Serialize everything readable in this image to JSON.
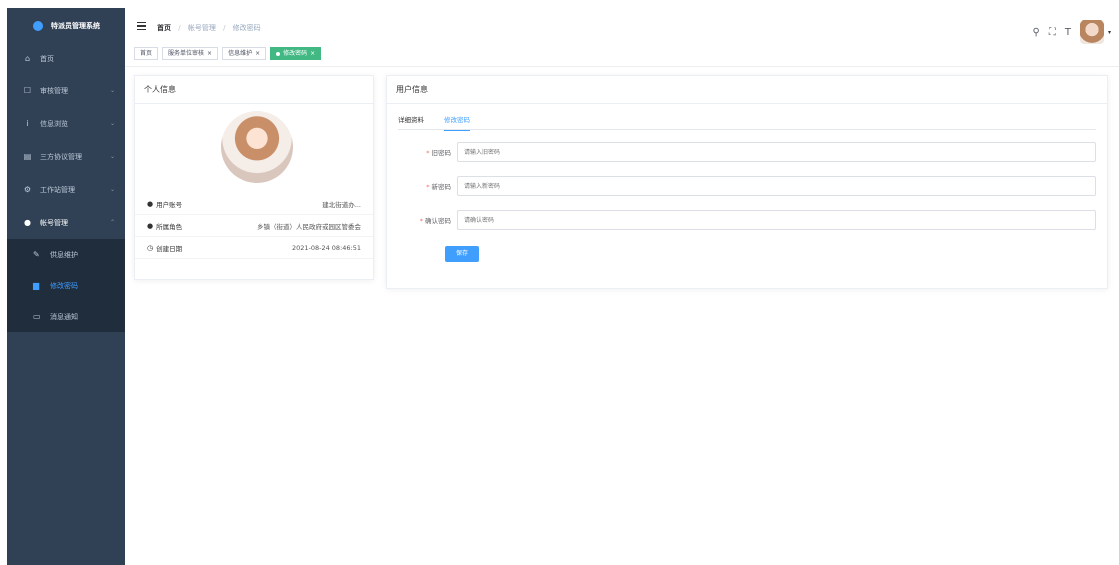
{
  "app": {
    "title": "特派员管理系统"
  },
  "sidebar": {
    "items": [
      {
        "label": "首页",
        "icon": "home-icon"
      },
      {
        "label": "审核管理",
        "icon": "audit-icon"
      },
      {
        "label": "信息浏览",
        "icon": "info-icon"
      },
      {
        "label": "三方协议管理",
        "icon": "agreement-icon"
      },
      {
        "label": "工作站管理",
        "icon": "station-icon"
      },
      {
        "label": "帐号管理",
        "icon": "user-icon"
      }
    ],
    "subitems": [
      {
        "label": "供息维护",
        "icon": "edit-icon"
      },
      {
        "label": "修改密码",
        "icon": "lock-icon"
      },
      {
        "label": "消息通知",
        "icon": "message-icon"
      }
    ]
  },
  "breadcrumb": {
    "home": "首页",
    "parent": "帐号管理",
    "current": "修改密码"
  },
  "tags": [
    {
      "label": "首页"
    },
    {
      "label": "服务单位审核"
    },
    {
      "label": "信息维护"
    },
    {
      "label": "修改密码"
    }
  ],
  "profile": {
    "title": "个人信息",
    "rows": [
      {
        "label": "用户账号",
        "value": "建北街道办..."
      },
      {
        "label": "所属角色",
        "value": "乡镇（街道）人民政府或园区管委会"
      },
      {
        "label": "创建日期",
        "value": "2021-08-24 08:46:51"
      }
    ]
  },
  "user_info": {
    "title": "用户信息",
    "tabs": [
      "详细资料",
      "修改密码"
    ],
    "fields": [
      {
        "label": "旧密码",
        "placeholder": "请输入旧密码"
      },
      {
        "label": "新密码",
        "placeholder": "请输入新密码"
      },
      {
        "label": "确认密码",
        "placeholder": "请确认密码"
      }
    ],
    "save_label": "保存"
  },
  "colors": {
    "sidebar": "#304156",
    "accent": "#409eff",
    "active_tag": "#42b983"
  }
}
